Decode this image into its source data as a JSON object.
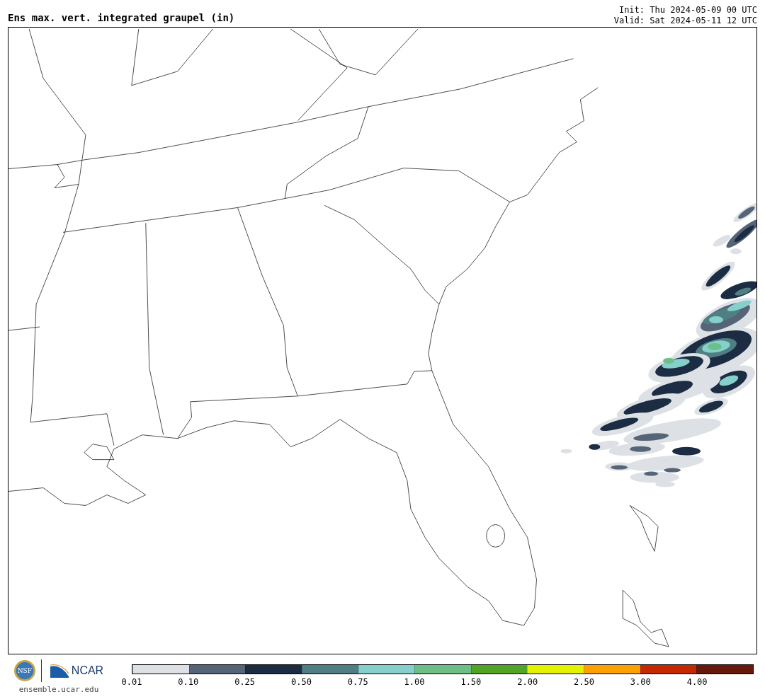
{
  "header": {
    "title": "Ens max. vert. integrated graupel (in)",
    "init": "Init: Thu 2024-05-09 00 UTC",
    "valid": "Valid: Sat 2024-05-11 12 UTC"
  },
  "footer": {
    "logos": [
      {
        "kind": "nsf",
        "text": "NSF"
      },
      {
        "kind": "ncar",
        "text": "NCAR"
      }
    ],
    "url": "ensemble.ucar.edu"
  },
  "legend": {
    "bins": [
      {
        "label": "0.01",
        "color": "#dde1e6"
      },
      {
        "label": "0.10",
        "color": "#566478"
      },
      {
        "label": "0.25",
        "color": "#1b2c43"
      },
      {
        "label": "0.50",
        "color": "#4f7f83"
      },
      {
        "label": "0.75",
        "color": "#86d0cc"
      },
      {
        "label": "1.00",
        "color": "#6cbf85"
      },
      {
        "label": "1.50",
        "color": "#53a326"
      },
      {
        "label": "2.00",
        "color": "#e3f200"
      },
      {
        "label": "2.50",
        "color": "#ffa000"
      },
      {
        "label": "3.00",
        "color": "#c62800"
      },
      {
        "label": "4.00",
        "color": "#651a0c"
      }
    ]
  }
}
